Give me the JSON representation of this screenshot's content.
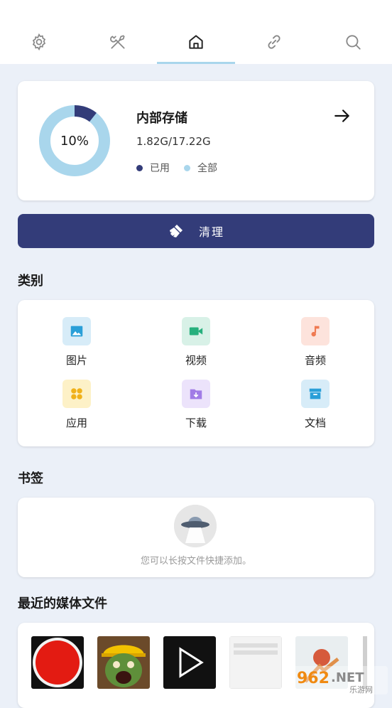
{
  "tabs": [
    {
      "name": "settings",
      "icon": "gear-icon"
    },
    {
      "name": "tools",
      "icon": "tools-icon"
    },
    {
      "name": "home",
      "icon": "home-icon",
      "active": true
    },
    {
      "name": "link",
      "icon": "link-icon"
    },
    {
      "name": "search",
      "icon": "search-icon"
    }
  ],
  "storage": {
    "title": "内部存储",
    "size": "1.82G/17.22G",
    "percent_label": "10%",
    "used_fraction": 0.106,
    "legend_used": "已用",
    "legend_all": "全部",
    "color_used": "#333c79",
    "color_all": "#a9d6ec"
  },
  "clean": {
    "label": "清理",
    "icon": "broom-icon"
  },
  "categories_title": "类别",
  "categories": [
    {
      "label": "图片",
      "icon": "image-icon",
      "bg": "#d7ecf8",
      "fg": "#2a9fd8"
    },
    {
      "label": "视频",
      "icon": "video-icon",
      "bg": "#d8f1e7",
      "fg": "#27b07d"
    },
    {
      "label": "音频",
      "icon": "music-icon",
      "bg": "#fde3dc",
      "fg": "#ef7a52"
    },
    {
      "label": "应用",
      "icon": "apps-icon",
      "bg": "#fdf1c7",
      "fg": "#f0b11a"
    },
    {
      "label": "下载",
      "icon": "download-folder-icon",
      "bg": "#ece3fb",
      "fg": "#a17ce6"
    },
    {
      "label": "文档",
      "icon": "archive-icon",
      "bg": "#d7ecf8",
      "fg": "#2a9fd8"
    }
  ],
  "bookmarks_title": "书签",
  "bookmarks_empty": "您可以长按文件快捷添加。",
  "recent_title": "最近的媒体文件",
  "recent_media": [
    {
      "icon": "record-icon"
    },
    {
      "icon": "zombie-game-icon"
    },
    {
      "icon": "play-icon"
    },
    {
      "icon": "document-thumbnail-icon"
    },
    {
      "icon": "poster-thumbnail-icon"
    }
  ],
  "watermark": {
    "text": "962.NET",
    "subtext": "乐游网"
  }
}
